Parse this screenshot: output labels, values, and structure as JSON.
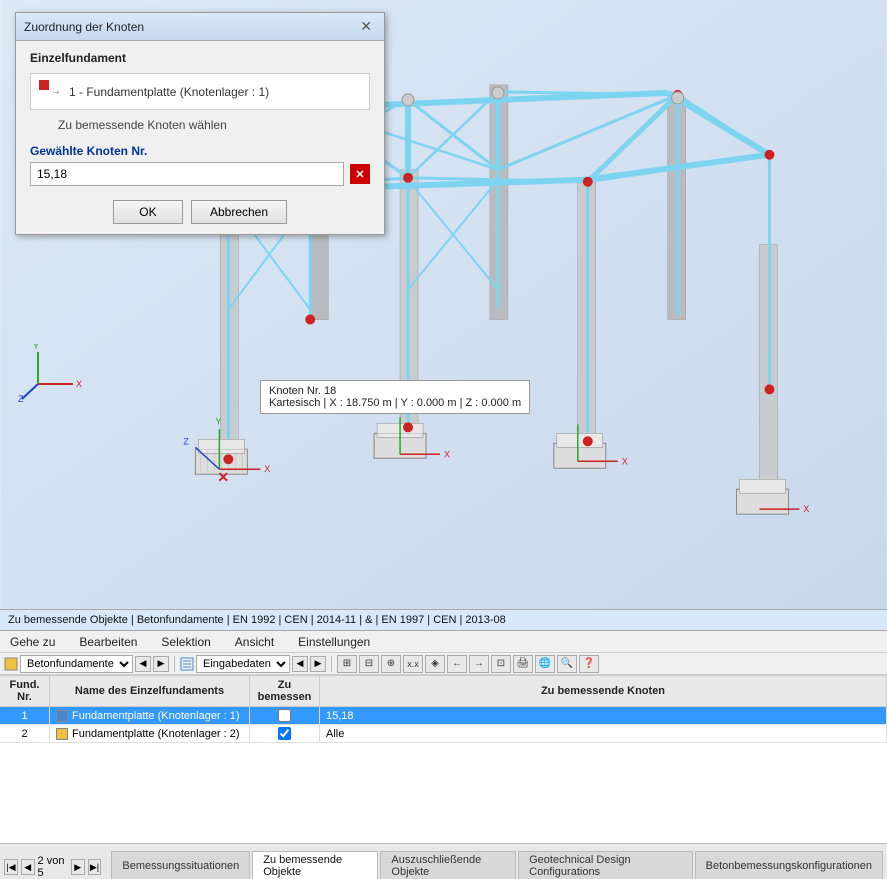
{
  "dialog": {
    "title": "Zuordnung der Knoten",
    "section_label": "Einzelfundament",
    "item_text": "1 - Fundamentplatte (Knotenlager : 1)",
    "instruction": "Zu bemessende Knoten wählen",
    "input_label": "Gewählte Knoten Nr.",
    "input_value": "15,18",
    "ok_label": "OK",
    "cancel_label": "Abbrechen"
  },
  "viewport": {
    "tooltip": {
      "line1": "Knoten Nr. 18",
      "line2": "Kartesisch | X : 18.750 m | Y : 0.000 m | Z : 0.000 m"
    }
  },
  "status_bar": {
    "text": "Zu bemessende Objekte | Betonfundamente | EN 1992 | CEN | 2014-11 | & | EN 1997 | CEN | 2013-08"
  },
  "menubar": {
    "items": [
      "Gehe zu",
      "Bearbeiten",
      "Selektion",
      "Ansicht",
      "Einstellungen"
    ]
  },
  "toolbar": {
    "module_label": "Betonfundamente",
    "view_label": "Eingabedaten"
  },
  "table": {
    "headers": {
      "col1_line1": "Fund.",
      "col1_line2": "Nr.",
      "col2": "Name des Einzelfundaments",
      "col3": "Zu bemessen",
      "col4": "Zu bemessende Knoten"
    },
    "rows": [
      {
        "nr": "1",
        "name": "Fundamentplatte (Knotenlager : 1)",
        "zu_bemessen": false,
        "knoten": "15,18",
        "highlighted": true,
        "icon_color": "blue"
      },
      {
        "nr": "2",
        "name": "Fundamentplatte (Knotenlager : 2)",
        "zu_bemessen": true,
        "knoten": "Alle",
        "highlighted": false,
        "icon_color": "yellow"
      }
    ]
  },
  "bottom_tabs": {
    "tabs": [
      {
        "label": "Bemessungssituationen",
        "active": false
      },
      {
        "label": "Zu bemessende Objekte",
        "active": true
      },
      {
        "label": "Auszuschließende Objekte",
        "active": false
      },
      {
        "label": "Geotechnical Design Configurations",
        "active": false
      },
      {
        "label": "Betonbemessungskonfigurationen",
        "active": false
      }
    ],
    "page_info": "2 von 5"
  }
}
